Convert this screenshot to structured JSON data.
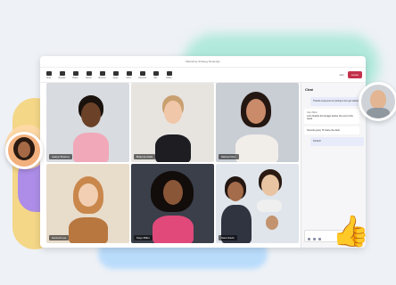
{
  "window": {
    "title": "Marketing Strategy Redesign"
  },
  "toolbar": {
    "items": [
      "Chat",
      "People",
      "Raise",
      "React",
      "Rooms",
      "Apps",
      "More",
      "Camera",
      "Mic",
      "Share"
    ],
    "leave_label": "Leave",
    "right_label": "Join"
  },
  "tiles": [
    {
      "name": "Aadya Sharma"
    },
    {
      "name": "Brianna Clark"
    },
    {
      "name": "Marisol Ruiz"
    },
    {
      "name": "Hannah Lee"
    },
    {
      "name": "Kayo Miller"
    },
    {
      "name": "Sara Davis"
    }
  ],
  "chat": {
    "title": "Chat",
    "messages": [
      {
        "from": "me",
        "who": "",
        "text": "Thanks everyone for joining! Let's get started."
      },
      {
        "from": "other",
        "who": "Kayo Miller",
        "text": "Let's finalize the budget before the end of the week."
      },
      {
        "from": "other",
        "who": "",
        "text": "Sounds great, I'll share the deck."
      },
      {
        "from": "me",
        "who": "",
        "text": "Perfect!"
      }
    ]
  },
  "colors": {
    "leave": "#c4314b",
    "accent": "#6264a7"
  },
  "icons": {
    "reaction": "thumbs-up-icon"
  }
}
